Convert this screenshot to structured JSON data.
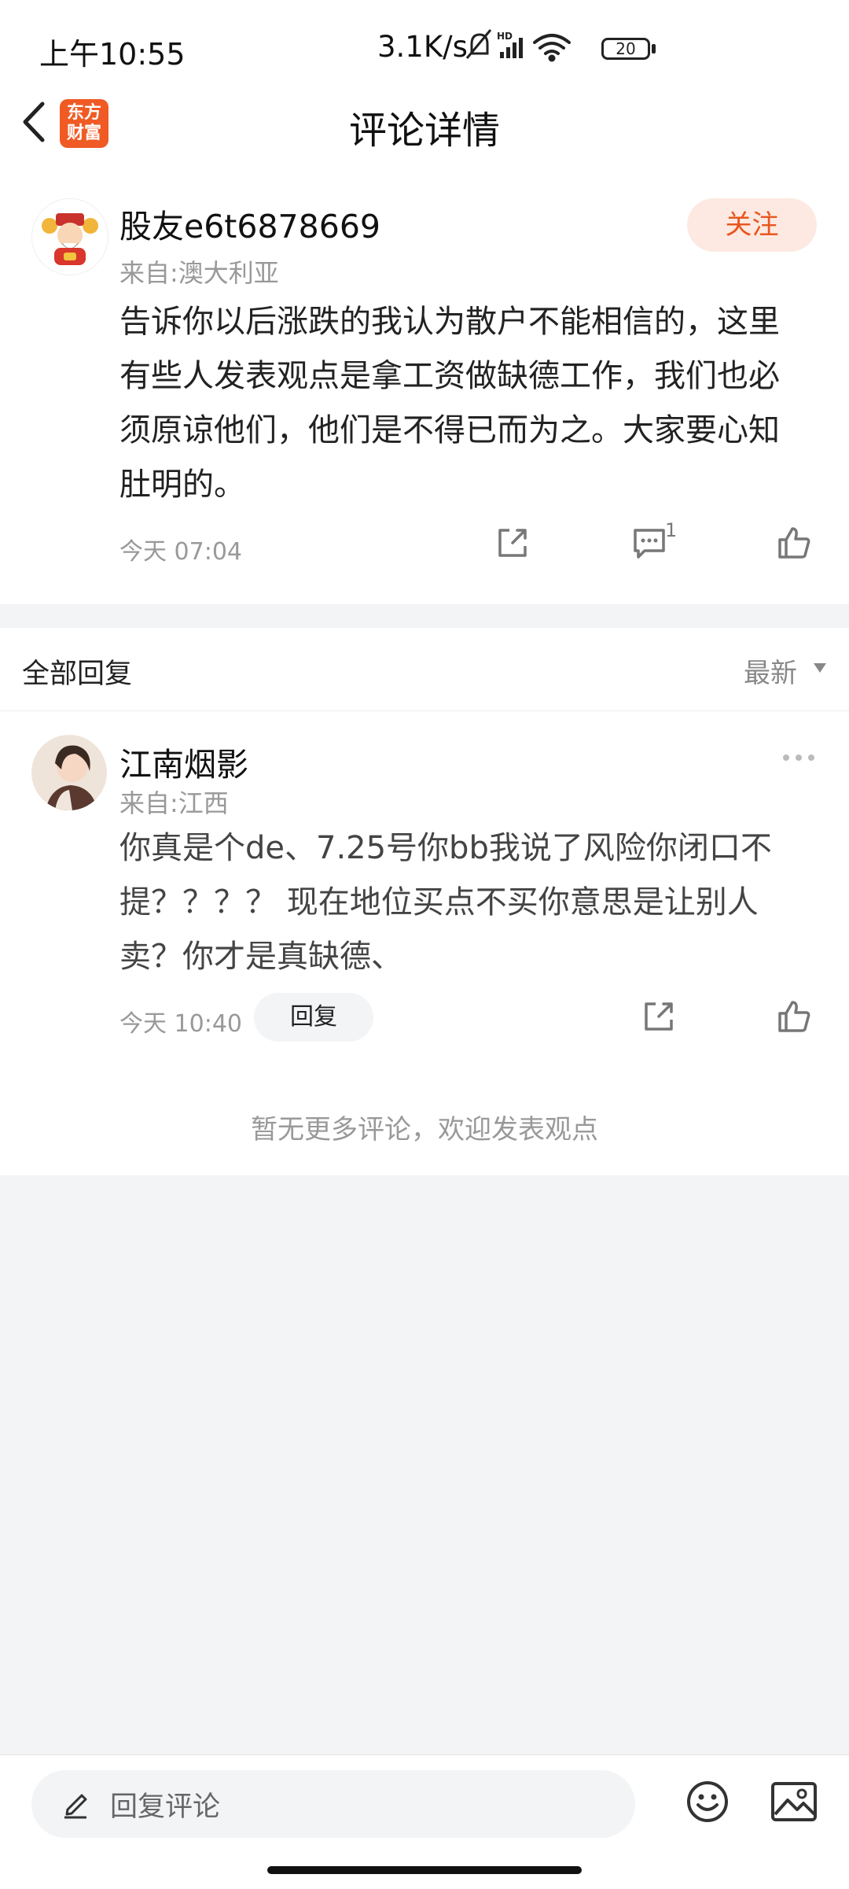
{
  "status_bar": {
    "time": "上午10:55",
    "net_speed": "3.1K/s",
    "battery": "20",
    "icons": [
      "mute-icon",
      "hd-signal-icon",
      "wifi-icon",
      "battery-icon"
    ]
  },
  "header": {
    "title": "评论详情",
    "logo_line1": "东方",
    "logo_line2": "财富"
  },
  "post": {
    "username": "股友e6t6878669",
    "location": "来自:澳大利亚",
    "follow_label": "关注",
    "content": "告诉你以后涨跌的我认为散户不能相信的，这里有些人发表观点是拿工资做缺德工作，我们也必须原谅他们，他们是不得已而为之。大家要心知肚明的。",
    "time": "今天 07:04",
    "comment_count": "1"
  },
  "replies": {
    "section_title": "全部回复",
    "sort_label": "最新",
    "items": [
      {
        "username": "江南烟影",
        "location": "来自:江西",
        "content": "你真是个de、7.25号你bb我说了风险你闭口不提？？？？ 现在地位买点不买你意思是让别人卖？你才是真缺德、",
        "time": "今天 10:40",
        "reply_label": "回复"
      }
    ],
    "no_more_text": "暂无更多评论，欢迎发表观点"
  },
  "bottom": {
    "input_placeholder": "回复评论"
  },
  "colors": {
    "accent": "#e8561e",
    "follow_bg": "#fde9e1",
    "page_bg": "#f3f4f6"
  }
}
